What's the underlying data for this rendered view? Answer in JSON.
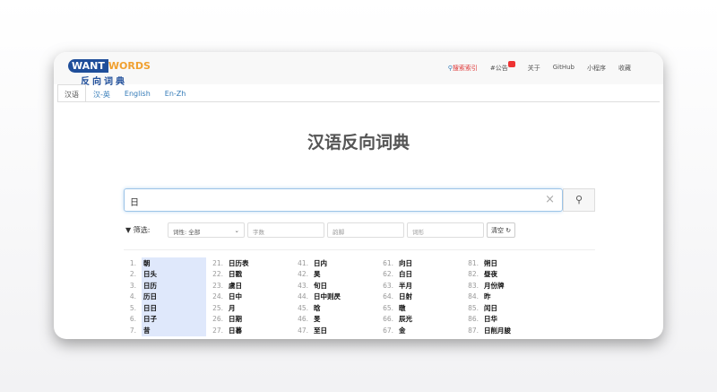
{
  "logo": {
    "want": "WANT",
    "words": "WORDS",
    "cn": "反向词典"
  },
  "nav": {
    "search_index": "搜索索引",
    "notice": "#公告",
    "about": "关于",
    "github": "GitHub",
    "miniapp": "小程序",
    "favorites": "收藏"
  },
  "tabs": [
    "汉语",
    "汉-英",
    "English",
    "En-Zh"
  ],
  "title": "汉语反向词典",
  "search": {
    "value": "日",
    "clear": "×",
    "button_icon": "search-icon"
  },
  "filters": {
    "label": "▼ 筛选:",
    "pos": "词性: 全部",
    "chars": "字数",
    "rhyme": "韵脚",
    "form": "词形",
    "clear": "清空 ↻"
  },
  "results": [
    [
      [
        "1.",
        "朝"
      ],
      [
        "2.",
        "日头"
      ],
      [
        "3.",
        "日历"
      ],
      [
        "4.",
        "历日"
      ],
      [
        "5.",
        "日日"
      ],
      [
        "6.",
        "日子"
      ],
      [
        "7.",
        "昔"
      ]
    ],
    [
      [
        "21.",
        "日历表"
      ],
      [
        "22.",
        "日戳"
      ],
      [
        "23.",
        "虞日"
      ],
      [
        "24.",
        "日中"
      ],
      [
        "25.",
        "月"
      ],
      [
        "26.",
        "日期"
      ],
      [
        "27.",
        "日暮"
      ]
    ],
    [
      [
        "41.",
        "日内"
      ],
      [
        "42.",
        "昊"
      ],
      [
        "43.",
        "旬日"
      ],
      [
        "44.",
        "日中则昃"
      ],
      [
        "45.",
        "晗"
      ],
      [
        "46.",
        "旻"
      ],
      [
        "47.",
        "至日"
      ]
    ],
    [
      [
        "61.",
        "向日"
      ],
      [
        "62.",
        "白日"
      ],
      [
        "63.",
        "半月"
      ],
      [
        "64.",
        "日射"
      ],
      [
        "65.",
        "暾"
      ],
      [
        "66.",
        "辰光"
      ],
      [
        "67.",
        "金"
      ]
    ],
    [
      [
        "81.",
        "朔日"
      ],
      [
        "82.",
        "昼夜"
      ],
      [
        "83.",
        "月份牌"
      ],
      [
        "84.",
        "昨"
      ],
      [
        "85.",
        "闰日"
      ],
      [
        "86.",
        "日华"
      ],
      [
        "87.",
        "日削月朘"
      ]
    ]
  ]
}
